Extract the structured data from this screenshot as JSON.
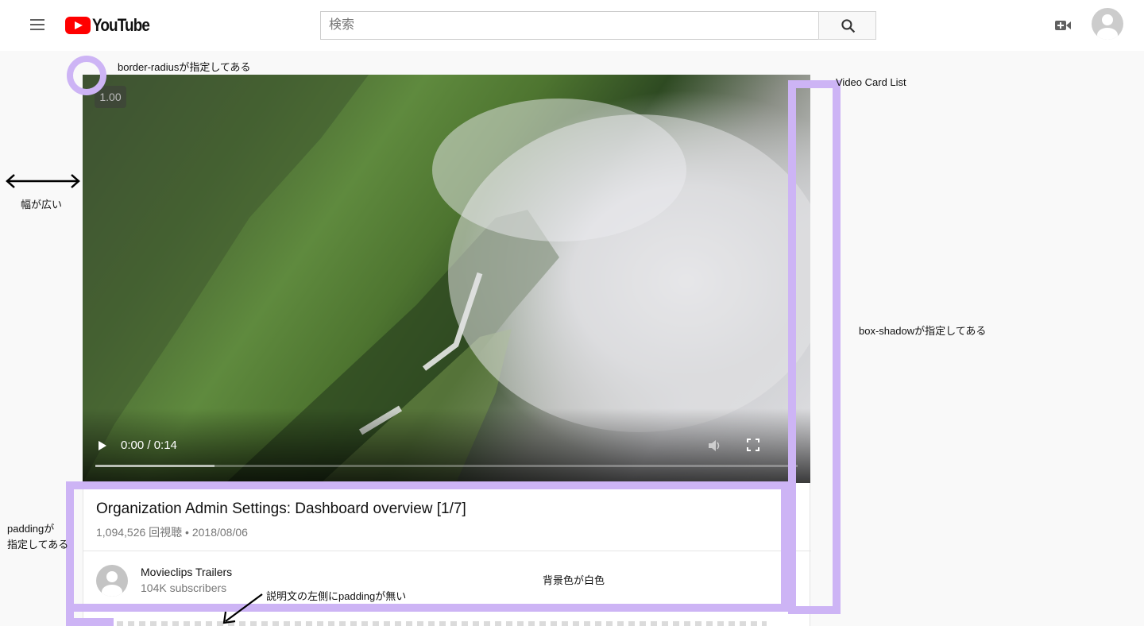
{
  "header": {
    "logo_text": "YouTube",
    "search_placeholder": "検索"
  },
  "video": {
    "speed": "1.00",
    "time": "0:00 / 0:14",
    "progress": 0.17
  },
  "info": {
    "title": "Organization Admin Settings: Dashboard overview [1/7]",
    "meta": "1,094,526 回視聴 • 2018/08/06",
    "channel_name": "Movieclips Trailers",
    "channel_subs": "104K subscribers"
  },
  "annotations": {
    "border_radius": "border-radiusが指定してある",
    "video_card_list": "Video Card List",
    "width_wide": "幅が広い",
    "box_shadow": "box-shadowが指定してある",
    "padding_line1": "paddingが",
    "padding_line2": "指定してある",
    "background_white": "背景色が白色",
    "desc_no_padding": "説明文の左側にpaddingが無い"
  },
  "colors": {
    "annotation_purple": "#cdb4f5",
    "brand_red": "#ff0000"
  },
  "icons": [
    "menu-icon",
    "youtube-logo-icon",
    "search-icon",
    "video-camera-icon",
    "account-icon",
    "play-icon",
    "volume-icon",
    "fullscreen-icon"
  ]
}
